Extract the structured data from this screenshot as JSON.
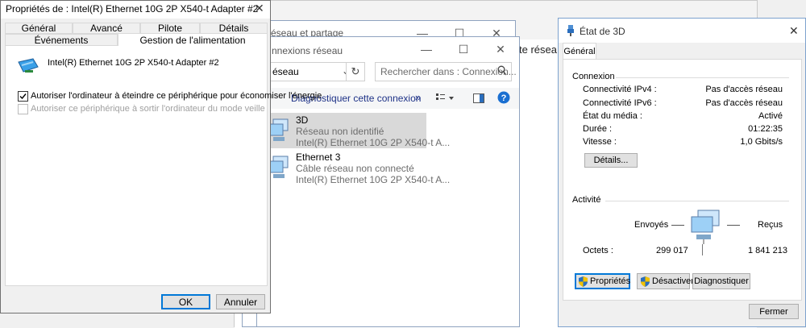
{
  "background_window": {
    "partial_text": "te résea"
  },
  "center_window": {
    "title": "éseau et partage"
  },
  "connections_window": {
    "title": "nnexions réseau",
    "address_value": "éseau",
    "search_placeholder": "Rechercher dans : Connexion...",
    "diagnose_label": "Diagnostiquer cette connexion",
    "more_label": "»",
    "items": [
      {
        "name": "3D",
        "status": "Réseau non identifié",
        "adapter": "Intel(R) Ethernet 10G 2P X540-t A..."
      },
      {
        "name": "Ethernet 3",
        "status": "Câble réseau non connecté",
        "adapter": "Intel(R) Ethernet 10G 2P X540-t A..."
      }
    ]
  },
  "properties_dialog": {
    "title": "Propriétés de : Intel(R) Ethernet 10G 2P X540-t Adapter #2",
    "tabs_row1": [
      "Général",
      "Avancé",
      "Pilote",
      "Détails"
    ],
    "tabs_row2": [
      "Événements",
      "Gestion de l'alimentation"
    ],
    "device_name": "Intel(R) Ethernet 10G 2P X540-t Adapter #2",
    "option1": "Autoriser l'ordinateur à éteindre ce périphérique pour économiser l'énergie",
    "option2": "Autoriser ce périphérique à sortir l'ordinateur du mode veille",
    "ok_label": "OK",
    "cancel_label": "Annuler"
  },
  "status_dialog": {
    "title": "État de 3D",
    "tab": "Général",
    "connection_group": "Connexion",
    "rows": [
      {
        "label": "Connectivité IPv4 :",
        "value": "Pas d'accès réseau"
      },
      {
        "label": "Connectivité IPv6 :",
        "value": "Pas d'accès réseau"
      },
      {
        "label": "État du média :",
        "value": "Activé"
      },
      {
        "label": "Durée :",
        "value": "01:22:35"
      },
      {
        "label": "Vitesse :",
        "value": "1,0 Gbits/s"
      }
    ],
    "details_label": "Détails...",
    "activity_group": "Activité",
    "sent_label": "Envoyés",
    "received_label": "Reçus",
    "bytes_label": "Octets :",
    "bytes_sent": "299 017",
    "bytes_received": "1 841 213",
    "properties_label": "Propriétés",
    "disable_label": "Désactiver",
    "diagnose_label": "Diagnostiquer",
    "close_label": "Fermer"
  },
  "colors": {
    "accent": "#0078d7",
    "selection": "#d9d9d9",
    "help": "#1a6fd1"
  }
}
